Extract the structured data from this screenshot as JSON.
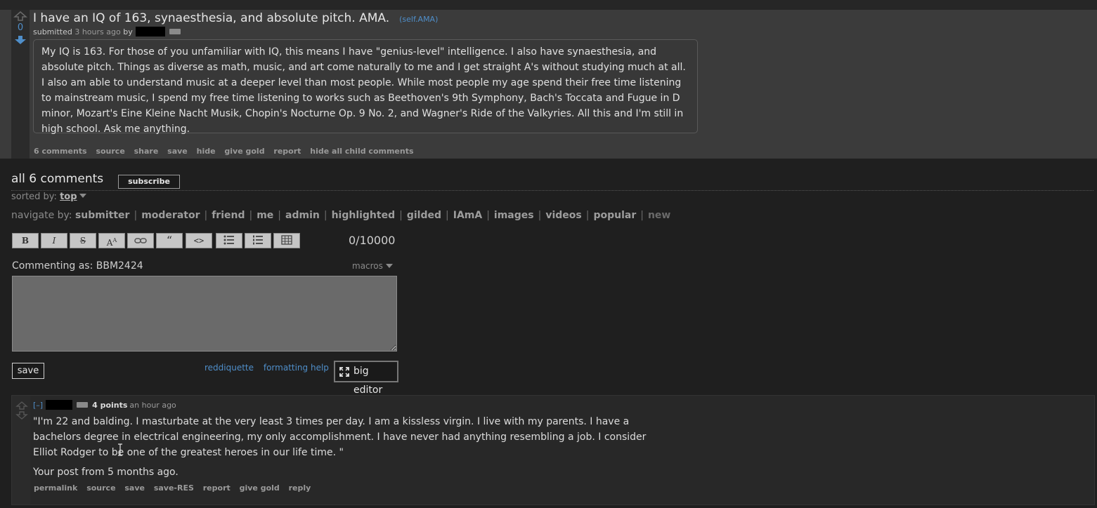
{
  "post": {
    "score": "0",
    "title": "I have an IQ of 163, synaesthesia, and absolute pitch. AMA.",
    "domain": "(self.AMA)",
    "submitted_prefix": "submitted",
    "age": "3 hours ago",
    "by_label": "by",
    "selftext": "My IQ is 163. For those of you unfamiliar with IQ, this means I have \"genius-level\" intelligence. I also have synaesthesia, and absolute pitch. Things as diverse as math, music, and art come naturally to me and I get straight A's without studying much at all. I also am able to understand music at a deeper level than most people. While most people my age spend their free time listening to mainstream music, I spend my free time listening to works such as Beethoven's 9th Symphony, Bach's Toccata and Fugue in D minor, Mozart's Eine Kleine Nacht Musik, Chopin's Nocturne Op. 9 No. 2, and Wagner's Ride of the Valkyries. All this and I'm still in high school. Ask me anything.",
    "buttons": [
      "6 comments",
      "source",
      "share",
      "save",
      "hide",
      "give gold",
      "report",
      "hide all child comments"
    ]
  },
  "comments_area": {
    "header": "all 6 comments",
    "subscribe_label": "subscribe",
    "sorted_by_label": "sorted by:",
    "sorted_by_value": "top",
    "navigate_label": "navigate by:",
    "navigate_items": [
      "submitter",
      "moderator",
      "friend",
      "me",
      "admin",
      "highlighted",
      "gilded",
      "IAmA",
      "images",
      "videos",
      "popular",
      "new"
    ]
  },
  "editor": {
    "toolbar": [
      {
        "label": "B",
        "icon": "bold-icon"
      },
      {
        "label": "I",
        "icon": "italic-icon"
      },
      {
        "label": "S",
        "icon": "strikethrough-icon"
      },
      {
        "label": "A",
        "icon": "superscript-icon"
      },
      {
        "label": "",
        "icon": "link-icon"
      },
      {
        "label": "“",
        "icon": "quote-icon"
      },
      {
        "label": "<>",
        "icon": "code-icon"
      },
      {
        "label": "",
        "icon": "bulleted-list-icon"
      },
      {
        "label": "",
        "icon": "numbered-list-icon"
      },
      {
        "label": "",
        "icon": "table-icon"
      }
    ],
    "char_count": "0/10000",
    "commenting_as": "Commenting as: BBM2424",
    "macros_label": "macros",
    "textarea_value": "",
    "save_label": "save",
    "reddiquette_label": "reddiquette",
    "formatting_help_label": "formatting help",
    "big_editor_label": "big editor"
  },
  "comment": {
    "collapse_label": "[–]",
    "points": "4 points",
    "age": "an hour ago",
    "quote": "\"I'm 22 and balding. I masturbate at the very least 3 times per day. I am a kissless virgin. I live with my parents. I have a bachelors degree in electrical engineering, my only accomplishment. I have never had anything resembling a job. I consider Elliot Rodger to be one of the greatest heroes in our life time. \"",
    "reply_line": "Your post from 5 months ago.",
    "buttons": [
      "permalink",
      "source",
      "save",
      "save-RES",
      "report",
      "give gold",
      "reply"
    ]
  },
  "colors": {
    "background": "#1f1f1f",
    "post_background": "#3b3b3b",
    "link_blue": "#4f8ec9",
    "text": "#dcdcdc"
  }
}
